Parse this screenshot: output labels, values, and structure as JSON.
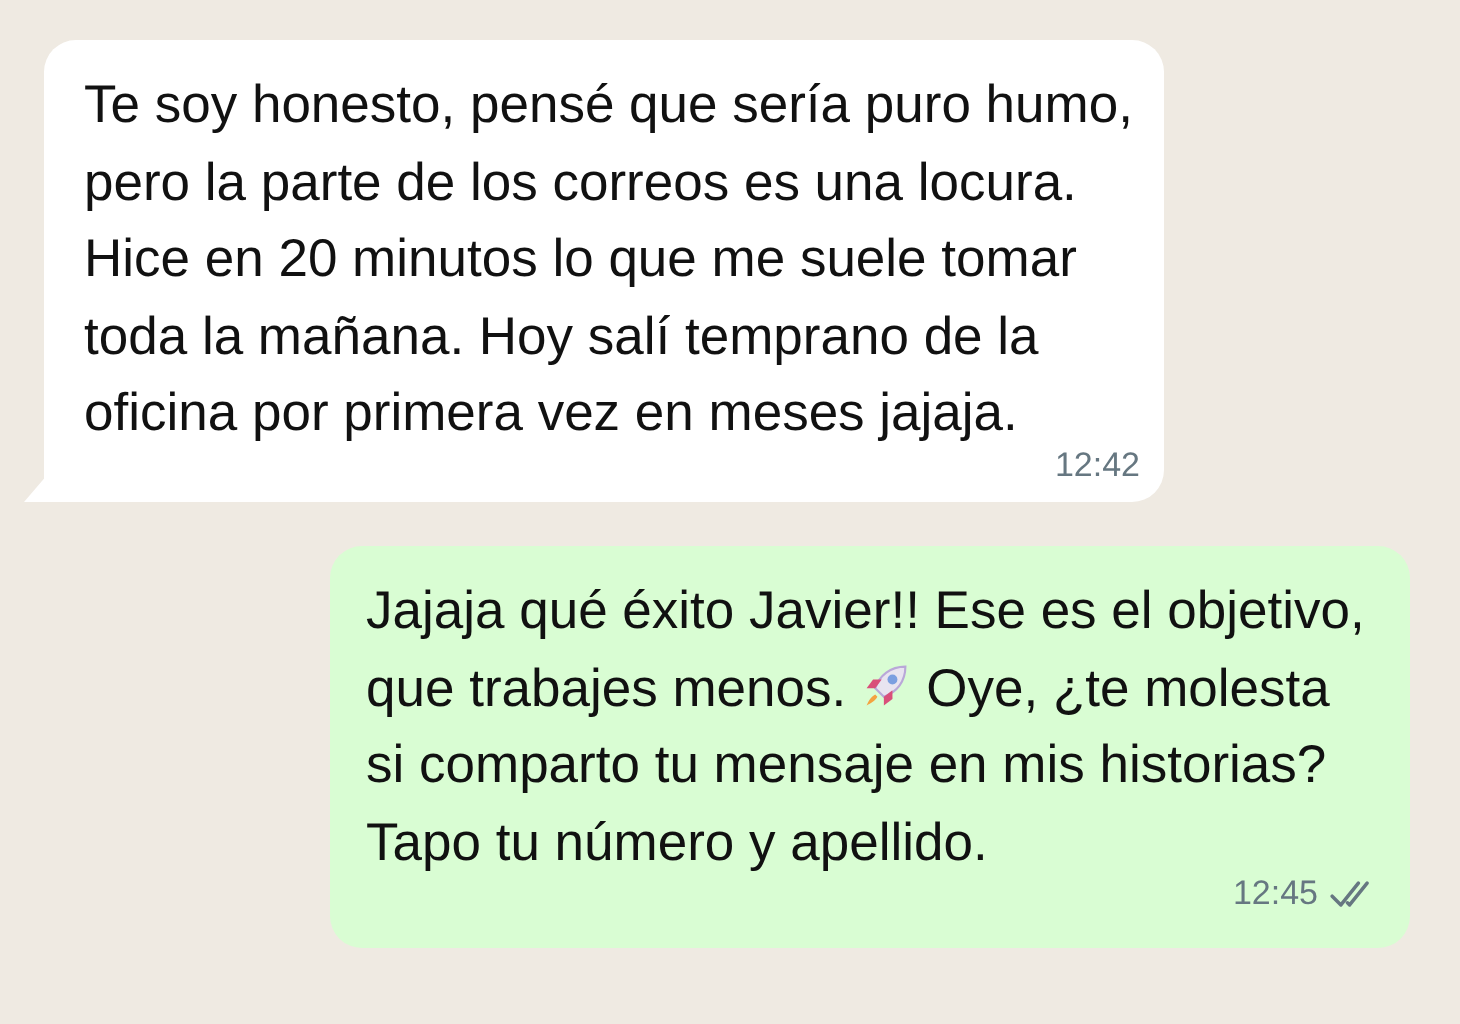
{
  "messages": [
    {
      "outgoing": false,
      "parts": [
        {
          "kind": "text",
          "text": "Te soy honesto, pensé que sería puro humo, pero la parte de los correos es una locura. Hice en 20 minutos lo que me suele tomar toda la mañana. Hoy salí temprano de la oficina por primera vez en meses jajaja."
        }
      ],
      "time": "12:42"
    },
    {
      "outgoing": true,
      "parts": [
        {
          "kind": "text",
          "text": "Jajaja qué éxito Javier!! Ese es el objetivo, que trabajes menos."
        },
        {
          "kind": "rocket"
        },
        {
          "kind": "text",
          "text": "Oye, ¿te molesta si comparto tu mensaje en mis historias? Tapo tu número y apellido."
        }
      ],
      "time": "12:45",
      "read": false
    }
  ]
}
